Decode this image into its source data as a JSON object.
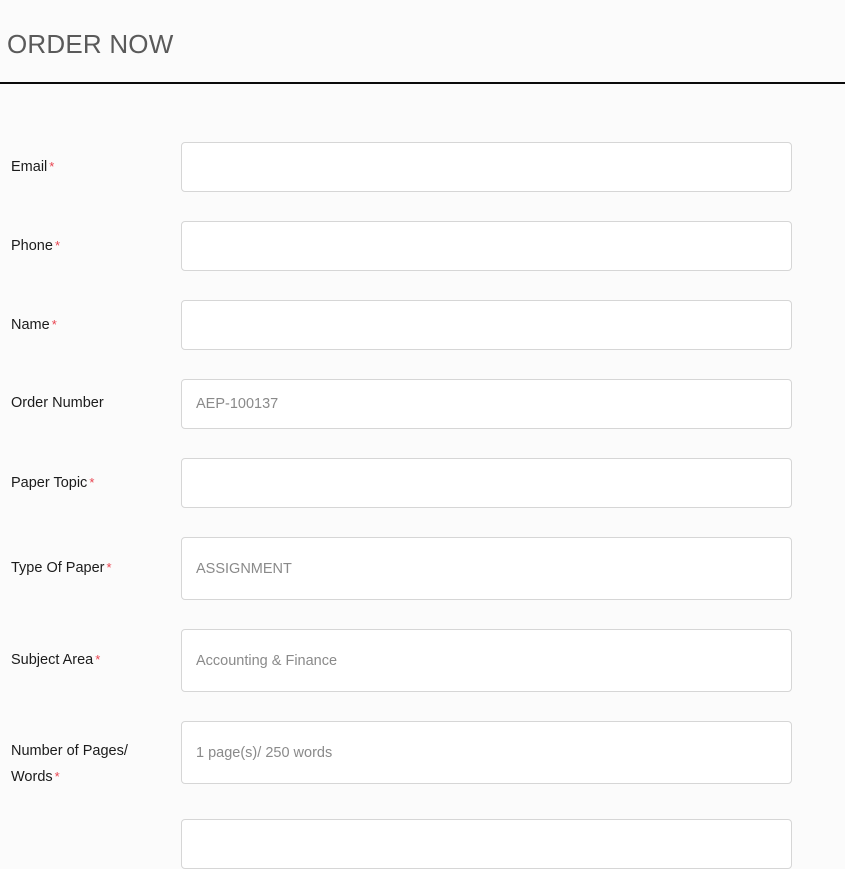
{
  "header": {
    "title": "ORDER NOW"
  },
  "form": {
    "fields": [
      {
        "label": "Email",
        "required": true,
        "required_mark": "*",
        "type": "text",
        "value": "",
        "placeholder": ""
      },
      {
        "label": "Phone",
        "required": true,
        "required_mark": "*",
        "type": "text",
        "value": "",
        "placeholder": ""
      },
      {
        "label": "Name",
        "required": true,
        "required_mark": "*",
        "type": "text",
        "value": "",
        "placeholder": ""
      },
      {
        "label": "Order Number",
        "required": false,
        "required_mark": "",
        "type": "text",
        "value": "",
        "placeholder": "AEP-100137"
      },
      {
        "label": "Paper Topic",
        "required": true,
        "required_mark": "*",
        "type": "text",
        "value": "",
        "placeholder": ""
      },
      {
        "label": "Type Of Paper",
        "required": true,
        "required_mark": "*",
        "type": "select",
        "value": "ASSIGNMENT",
        "placeholder": "ASSIGNMENT"
      },
      {
        "label": "Subject Area",
        "required": true,
        "required_mark": "*",
        "type": "select",
        "value": "Accounting & Finance",
        "placeholder": "Accounting & Finance"
      },
      {
        "label": "Number of Pages/ Words",
        "required": true,
        "required_mark": "*",
        "type": "select",
        "value": "1 page(s)/ 250 words",
        "placeholder": "1 page(s)/ 250 words"
      },
      {
        "label": "",
        "required": false,
        "required_mark": "",
        "type": "text",
        "value": "",
        "placeholder": ""
      }
    ]
  },
  "colors": {
    "page_background": "#fbfbfb",
    "input_background": "#ffffff",
    "input_border": "#d6d6d6",
    "title_text": "#5a5a5a",
    "label_text": "#1b1b1b",
    "placeholder_text": "#8a8a8a",
    "required_asterisk": "#e8434f",
    "divider": "#0a0a0a"
  }
}
